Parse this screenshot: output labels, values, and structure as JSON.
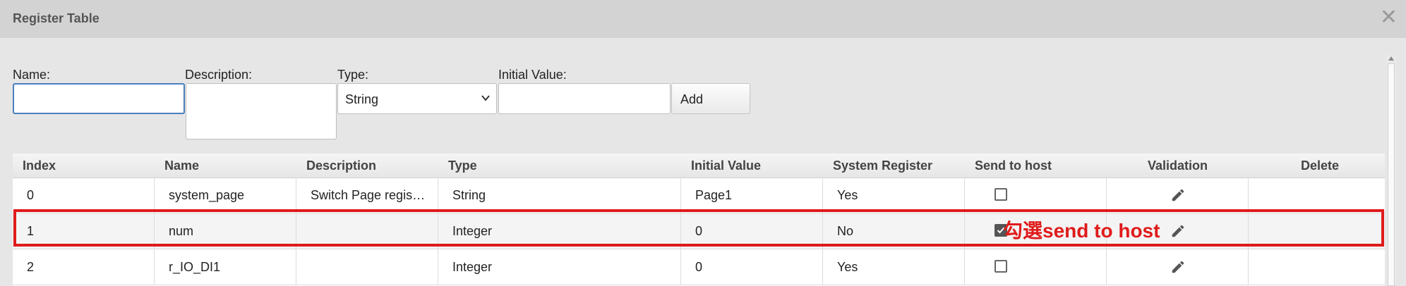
{
  "dialog": {
    "title": "Register Table",
    "close_icon": "close-icon"
  },
  "form": {
    "name_label": "Name:",
    "name_value": "",
    "description_label": "Description:",
    "description_value": "",
    "type_label": "Type:",
    "type_selected": "String",
    "initial_value_label": "Initial Value:",
    "initial_value": "",
    "add_label": "Add"
  },
  "table": {
    "columns": [
      "Index",
      "Name",
      "Description",
      "Type",
      "Initial Value",
      "System Register",
      "Send to host",
      "Validation",
      "Delete"
    ],
    "rows": [
      {
        "index": "0",
        "name": "system_page",
        "description": "Switch Page regis…",
        "type": "String",
        "initial": "Page1",
        "system": "Yes",
        "send_to_host": false
      },
      {
        "index": "1",
        "name": "num",
        "description": "",
        "type": "Integer",
        "initial": "0",
        "system": "No",
        "send_to_host": true
      },
      {
        "index": "2",
        "name": "r_IO_DI1",
        "description": "",
        "type": "Integer",
        "initial": "0",
        "system": "Yes",
        "send_to_host": false
      }
    ]
  },
  "annotation": {
    "text": "勾選send to host",
    "color": "#e01b1b"
  }
}
